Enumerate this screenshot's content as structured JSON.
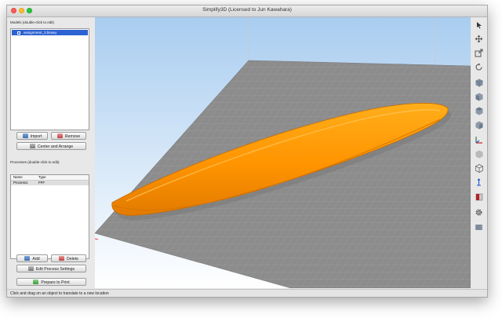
{
  "window": {
    "title": "Simplify3D (Licensed to Jun Kawahara)"
  },
  "models": {
    "label": "Models (double-click to edit)",
    "items": [
      {
        "name": "assignment_3.binary"
      }
    ],
    "import_label": "Import",
    "remove_label": "Remove",
    "center_label": "Center and Arrange"
  },
  "processes": {
    "label": "Processes (double-click to edit)",
    "columns": [
      "Name",
      "Type"
    ],
    "rows": [
      {
        "name": "Process1",
        "type": "FFF"
      }
    ],
    "add_label": "Add",
    "delete_label": "Delete",
    "edit_label": "Edit Process Settings"
  },
  "prepare_label": "Prepare to Print",
  "status": {
    "text": "Click and drag on an object to translate to a new location"
  },
  "toolbar": {
    "tools": [
      "select-arrow-icon",
      "move-icon",
      "scale-icon",
      "rotate-icon",
      "view-iso-cube-icon",
      "view-front-cube-icon",
      "view-top-cube-icon",
      "view-side-cube-icon",
      "axes-icon",
      "shaded-cube-icon",
      "wireframe-cube-icon",
      "vertical-axis-icon",
      "cross-section-icon",
      "gear-icon",
      "layer-view-icon"
    ]
  },
  "colors": {
    "model": "#ff9a00",
    "bed": "#8c8c8c",
    "selection": "#2d62d2",
    "sky_top": "#a9cdf0",
    "sky_bottom": "#ffffff"
  }
}
